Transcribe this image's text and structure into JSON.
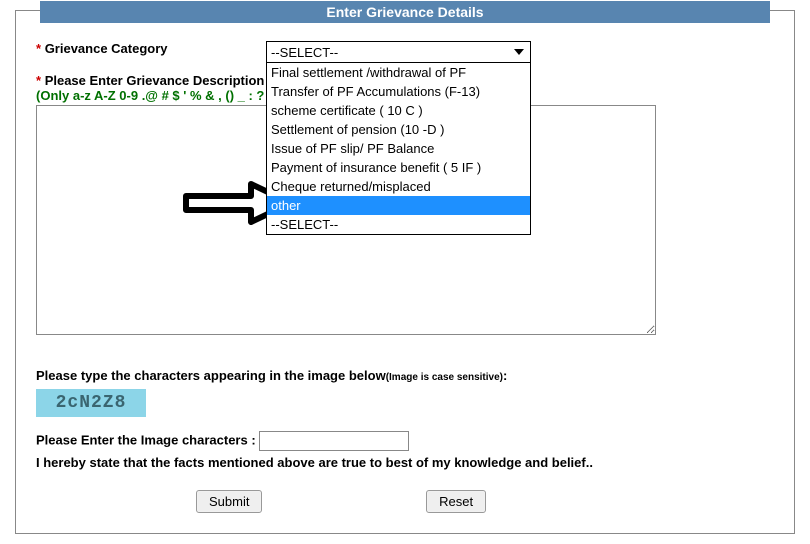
{
  "header": {
    "title": "Enter Grievance Details"
  },
  "field_category": {
    "asterisk": "*",
    "label": "Grievance Category",
    "selected": "--SELECT--",
    "options": [
      "Final settlement /withdrawal of PF",
      "Transfer of PF Accumulations (F-13)",
      "scheme certificate ( 10 C )",
      "Settlement of pension (10 -D )",
      "Issue of PF slip/ PF Balance",
      "Payment of insurance benefit ( 5 IF )",
      "Cheque returned/misplaced",
      "other",
      "--SELECT--"
    ],
    "highlight_index": 7
  },
  "field_description": {
    "asterisk": "*",
    "label": "Please Enter Grievance Description :",
    "hint": "(Only a-z A-Z 0-9 .@ # $ ' % & , () _ : ?"
  },
  "captcha": {
    "header_main": "Please type the characters appearing in the image below",
    "header_note": "(Image is case sensitive)",
    "colon": ":",
    "image_text": "2cN2Z8",
    "input_label": "Please Enter the Image characters :"
  },
  "declaration_text": "I hereby state that the facts mentioned above are true to best of my knowledge and belief..",
  "buttons": {
    "submit": "Submit",
    "reset": "Reset"
  }
}
